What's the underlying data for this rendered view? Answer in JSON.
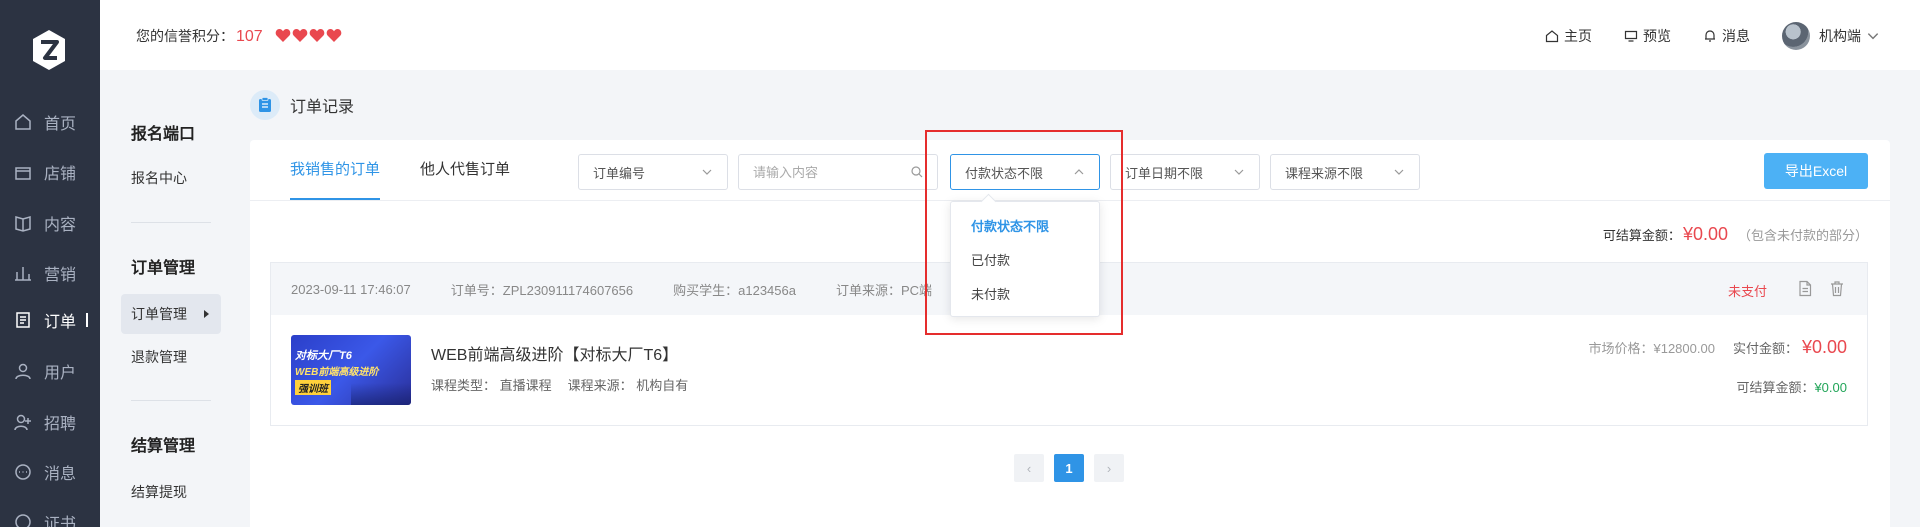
{
  "rail": {
    "logo_icon": "z-logo-icon",
    "items": [
      {
        "label": "首页",
        "icon": "home-icon"
      },
      {
        "label": "店铺",
        "icon": "store-icon"
      },
      {
        "label": "内容",
        "icon": "book-icon"
      },
      {
        "label": "营销",
        "icon": "chart-icon"
      },
      {
        "label": "订单",
        "icon": "order-icon",
        "active": true
      },
      {
        "label": "用户",
        "icon": "user-icon"
      },
      {
        "label": "招聘",
        "icon": "recruit-icon"
      },
      {
        "label": "消息",
        "icon": "message-icon"
      },
      {
        "label": "证书",
        "icon": "certificate-icon"
      }
    ]
  },
  "header": {
    "credit_label": "您的信誉积分：",
    "credit_score": "107",
    "hearts": 4,
    "nav": [
      {
        "label": "主页",
        "icon": "home-icon"
      },
      {
        "label": "预览",
        "icon": "monitor-icon"
      },
      {
        "label": "消息",
        "icon": "bell-icon"
      }
    ],
    "user_name": "机构端"
  },
  "subnav": {
    "sections": [
      {
        "title": "报名端口",
        "items": [
          "报名中心"
        ]
      },
      {
        "title": "订单管理",
        "items": [
          "订单管理",
          "退款管理"
        ]
      },
      {
        "title": "结算管理",
        "items": [
          "结算提现"
        ]
      }
    ]
  },
  "breadcrumb": {
    "title": "订单记录"
  },
  "tabs": [
    "我销售的订单",
    "他人代售订单"
  ],
  "filters": {
    "order_field": "订单编号",
    "search_placeholder": "请输入内容",
    "pay_status": "付款状态不限",
    "order_date": "订单日期不限",
    "course_source": "课程来源不限",
    "export_label": "导出Excel"
  },
  "settlement": {
    "label": "可结算金额：",
    "amount": "¥0.00",
    "note": "（包含未付款的部分）"
  },
  "order": {
    "time": "2023-09-11 17:46:07",
    "order_no": "订单号：ZPL230911174607656",
    "buyer": "购买学生：a123456a",
    "source": "订单来源：PC端",
    "status": "未支付",
    "thumb_line1": "对标大厂T6",
    "thumb_line2": "WEB前端高级进阶",
    "thumb_line3": "强训班",
    "course_title": "WEB前端高级进阶【对标大厂T6】",
    "course_type": "课程类型： 直播课程",
    "course_source": "课程来源： 机构自有",
    "market_price": "市场价格：¥12800.00",
    "paid_label": "实付金额：",
    "paid_amount": "¥0.00",
    "settle_label": "可结算金额：",
    "settle_amount": "¥0.00"
  },
  "pagination": {
    "prev": "‹",
    "current": "1",
    "next": "›"
  },
  "dropdown": {
    "options": [
      "付款状态不限",
      "已付款",
      "未付款"
    ],
    "selected": 0
  },
  "colors": {
    "accent": "#2f94e6",
    "danger": "#e9484f",
    "success": "#22a559",
    "rail_bg": "#2c3342",
    "highlight_box": "#e52d2d"
  }
}
